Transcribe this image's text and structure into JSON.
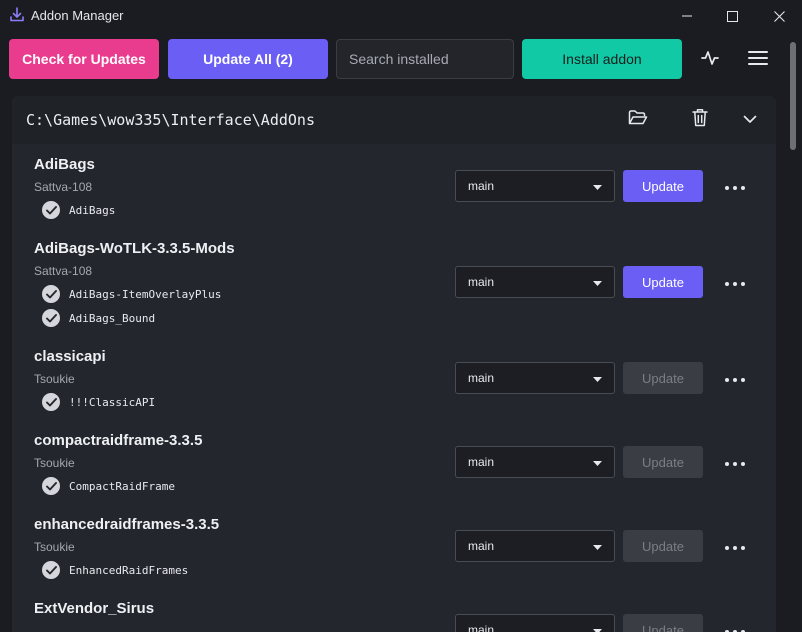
{
  "window": {
    "title": "Addon Manager",
    "icon": "download-icon",
    "controls": [
      "minimize-icon",
      "maximize-icon",
      "close-icon"
    ]
  },
  "toolbar": {
    "check_label": "Check for Updates",
    "update_all_label": "Update All (2)",
    "search_placeholder": "Search installed",
    "search_value": "",
    "install_label": "Install addon",
    "activity_icon": "activity-icon",
    "menu_icon": "hamburger-menu-icon"
  },
  "colors": {
    "check": "#ea3c8f",
    "update_all": "#6a5ef4",
    "install": "#12c9a6",
    "update_enabled": "#6a5ef4",
    "update_disabled": "#3a3d44"
  },
  "folder": {
    "path": "C:\\Games\\wow335\\Interface\\AddOns",
    "open_icon": "folder-open-icon",
    "delete_icon": "trash-icon",
    "collapse_icon": "chevron-down-icon"
  },
  "addons": [
    {
      "name": "AdiBags",
      "author": "Sattva-108",
      "subs": [
        "AdiBags"
      ],
      "branch": "main",
      "update_label": "Update",
      "update_enabled": true
    },
    {
      "name": "AdiBags-WoTLK-3.3.5-Mods",
      "author": "Sattva-108",
      "subs": [
        "AdiBags-ItemOverlayPlus",
        "AdiBags_Bound"
      ],
      "branch": "main",
      "update_label": "Update",
      "update_enabled": true
    },
    {
      "name": "classicapi",
      "author": "Tsoukie",
      "subs": [
        "!!!ClassicAPI"
      ],
      "branch": "main",
      "update_label": "Update",
      "update_enabled": false
    },
    {
      "name": "compactraidframe-3.3.5",
      "author": "Tsoukie",
      "subs": [
        "CompactRaidFrame"
      ],
      "branch": "main",
      "update_label": "Update",
      "update_enabled": false
    },
    {
      "name": "enhancedraidframes-3.3.5",
      "author": "Tsoukie",
      "subs": [
        "EnhancedRaidFrames"
      ],
      "branch": "main",
      "update_label": "Update",
      "update_enabled": false
    },
    {
      "name": "ExtVendor_Sirus",
      "author": "",
      "subs": [],
      "branch": "main",
      "update_label": "Update",
      "update_enabled": false
    }
  ]
}
